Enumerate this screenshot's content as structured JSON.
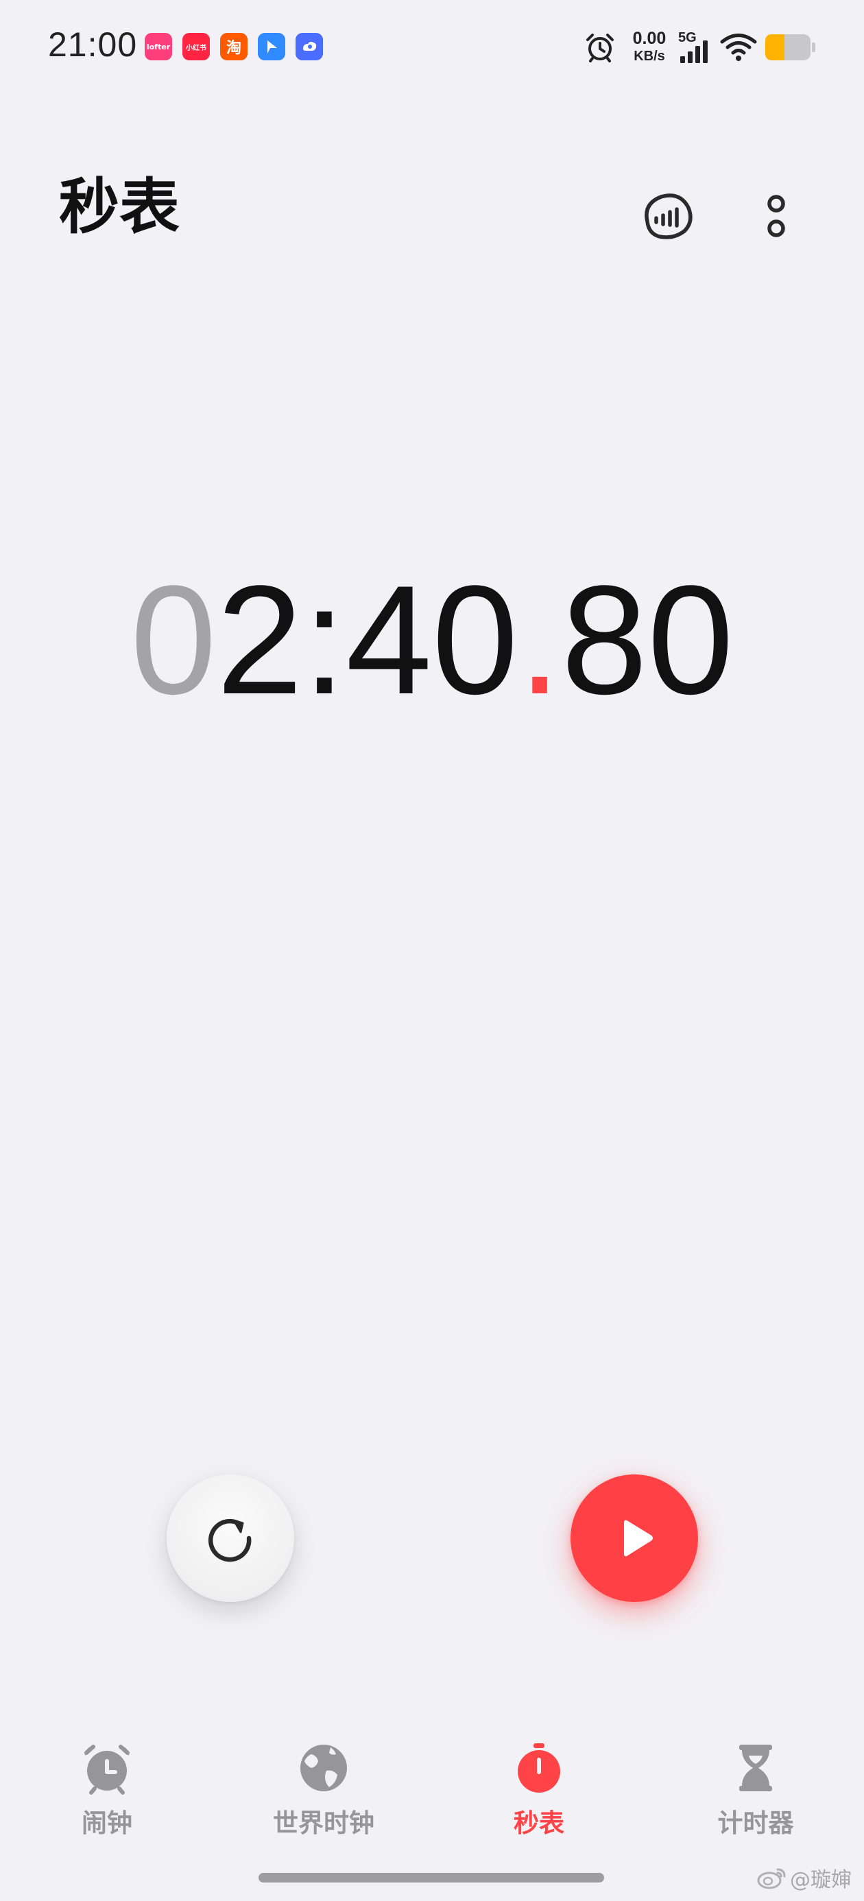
{
  "status_bar": {
    "time": "21:00",
    "apps": [
      {
        "name": "lofter-app-icon",
        "label": "lofter",
        "color": "#ff3f7d"
      },
      {
        "name": "xiaohongshu-app-icon",
        "label": "小红书",
        "color": "#ff2442"
      },
      {
        "name": "taobao-app-icon",
        "label": "淘",
        "color": "#ff5a00"
      },
      {
        "name": "flyme-app-icon",
        "label": "",
        "color": "#2f8bff"
      },
      {
        "name": "cloud-app-icon",
        "label": "",
        "color": "#4a6cff"
      }
    ],
    "net_speed_value": "0.00",
    "net_speed_unit": "KB/s",
    "signal_label": "5G"
  },
  "header": {
    "title": "秒表"
  },
  "stopwatch": {
    "d1": "0",
    "d2": "2",
    "colon": ":",
    "d3": "4",
    "d4": "0",
    "dot": ".",
    "d5": "8",
    "d6": "0"
  },
  "nav": {
    "tabs": [
      {
        "label": "闹钟",
        "icon": "alarm-clock-icon",
        "active": false
      },
      {
        "label": "世界时钟",
        "icon": "globe-icon",
        "active": false
      },
      {
        "label": "秒表",
        "icon": "stopwatch-icon",
        "active": true
      },
      {
        "label": "计时器",
        "icon": "hourglass-icon",
        "active": false
      }
    ]
  },
  "watermark": {
    "text": "@璇婶"
  },
  "colors": {
    "accent": "#ff4347",
    "background": "#f2f1f5",
    "inactive": "#969698",
    "battery": "#ffb300"
  }
}
